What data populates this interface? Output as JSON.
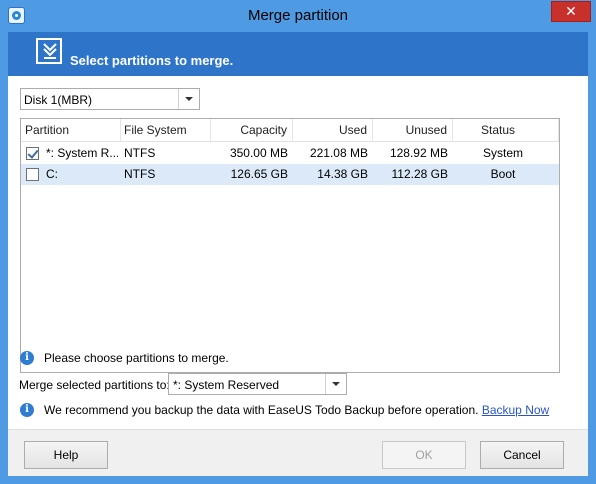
{
  "window": {
    "title": "Merge partition",
    "close_glyph": "✕"
  },
  "banner": {
    "text": "Select partitions to merge.",
    "icon": "merge-arrow-icon"
  },
  "disk_select": {
    "value": "Disk 1(MBR)"
  },
  "table": {
    "columns": [
      "Partition",
      "File System",
      "Capacity",
      "Used",
      "Unused",
      "Status"
    ],
    "rows": [
      {
        "checked": true,
        "partition": "*: System R...",
        "file_system": "NTFS",
        "capacity": "350.00 MB",
        "used": "221.08 MB",
        "unused": "128.92 MB",
        "status": "System"
      },
      {
        "checked": false,
        "partition": "C:",
        "file_system": "NTFS",
        "capacity": "126.65 GB",
        "used": "14.38 GB",
        "unused": "112.28 GB",
        "status": "Boot"
      }
    ]
  },
  "hint": {
    "text": "Please choose partitions to merge.",
    "icon": "i"
  },
  "merge_target": {
    "label": "Merge selected partitions to:",
    "value": "*: System Reserved"
  },
  "backup_note": {
    "text": "We recommend you backup the data with EaseUS Todo Backup before operation.",
    "link": "Backup Now",
    "icon": "i"
  },
  "buttons": {
    "help": "Help",
    "ok": "OK",
    "cancel": "Cancel"
  },
  "colors": {
    "title_bar": "#4f9be3",
    "banner": "#2e74c9",
    "selected_row": "#dbe9f9",
    "close_button": "#c7302b",
    "link": "#2b56c8"
  }
}
